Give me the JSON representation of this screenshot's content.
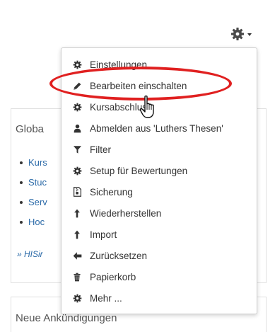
{
  "header": {
    "settings_icon": "gear-icon",
    "caret_icon": "chevron-down-icon"
  },
  "blocks": {
    "global": {
      "title": "Globa",
      "items": [
        "Kurs",
        "Stuc",
        "Serv",
        "Hoc"
      ],
      "more_link": "» HISir"
    },
    "news": {
      "title": "Neue Ankündigungen"
    }
  },
  "menu": {
    "items": [
      {
        "label": "Einstellungen",
        "icon": "gear-icon"
      },
      {
        "label": "Bearbeiten einschalten",
        "icon": "pencil-icon"
      },
      {
        "label": "Kursabschluss",
        "icon": "gear-icon"
      },
      {
        "label": "Abmelden aus 'Luthers Thesen'",
        "icon": "user-icon"
      },
      {
        "label": "Filter",
        "icon": "filter-icon"
      },
      {
        "label": "Setup für Bewertungen",
        "icon": "gear-icon"
      },
      {
        "label": "Sicherung",
        "icon": "file-archive-icon"
      },
      {
        "label": "Wiederherstellen",
        "icon": "upload-icon"
      },
      {
        "label": "Import",
        "icon": "upload-icon"
      },
      {
        "label": "Zurücksetzen",
        "icon": "arrow-left-icon"
      },
      {
        "label": "Papierkorb",
        "icon": "trash-icon"
      },
      {
        "label": "Mehr ...",
        "icon": "gear-icon"
      }
    ]
  },
  "colors": {
    "link": "#2b6aa8",
    "text": "#333333",
    "highlight": "#e02020"
  }
}
